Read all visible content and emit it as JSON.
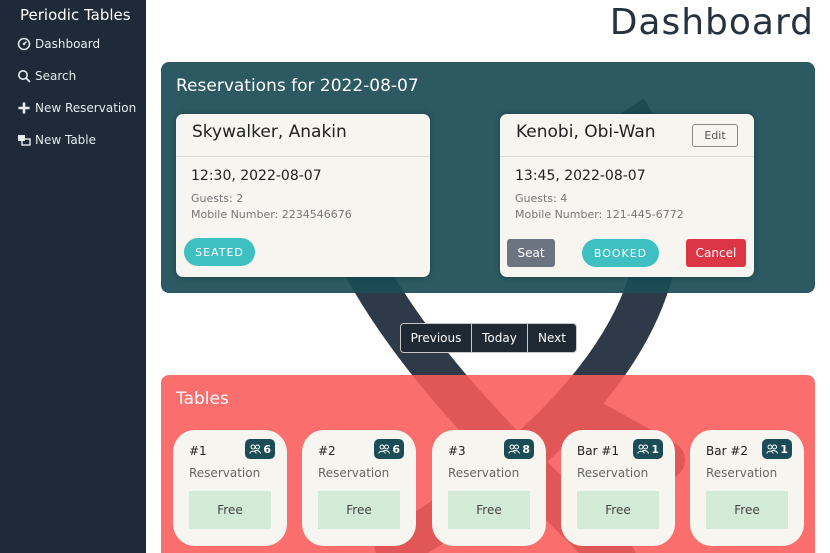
{
  "sidebar": {
    "brand": "Periodic Tables",
    "items": [
      {
        "label": "Dashboard",
        "icon": "dashboard-icon"
      },
      {
        "label": "Search",
        "icon": "search-icon"
      },
      {
        "label": "New Reservation",
        "icon": "plus-icon"
      },
      {
        "label": "New Table",
        "icon": "table-icon"
      }
    ]
  },
  "page": {
    "title": "Dashboard"
  },
  "reservations": {
    "title": "Reservations for 2022-08-07",
    "cards": [
      {
        "name": "Skywalker, Anakin",
        "datetime": "12:30, 2022-08-07",
        "guests": "Guests: 2",
        "mobile": "Mobile Number: 2234546676",
        "status": "SEATED"
      },
      {
        "name": "Kenobi, Obi-Wan",
        "datetime": "13:45, 2022-08-07",
        "guests": "Guests: 4",
        "mobile": "Mobile Number: 121-445-6772",
        "status": "BOOKED",
        "edit_label": "Edit",
        "seat_label": "Seat",
        "cancel_label": "Cancel"
      }
    ]
  },
  "pager": {
    "previous": "Previous",
    "today": "Today",
    "next": "Next"
  },
  "tables": {
    "title": "Tables",
    "items": [
      {
        "name": "#1",
        "capacity": "6",
        "reservation": "Reservation",
        "status": "Free"
      },
      {
        "name": "#2",
        "capacity": "6",
        "reservation": "Reservation",
        "status": "Free"
      },
      {
        "name": "#3",
        "capacity": "8",
        "reservation": "Reservation",
        "status": "Free"
      },
      {
        "name": "Bar #1",
        "capacity": "1",
        "reservation": "Reservation",
        "status": "Free"
      },
      {
        "name": "Bar #2",
        "capacity": "1",
        "reservation": "Reservation",
        "status": "Free"
      }
    ]
  },
  "colors": {
    "sidebar": "#1e2a38",
    "reservations_panel": "#1c4c56",
    "tables_panel": "#fa5a5a",
    "accent_teal": "#3ec0c3",
    "danger": "#dc3545",
    "free": "#d3ead6"
  }
}
